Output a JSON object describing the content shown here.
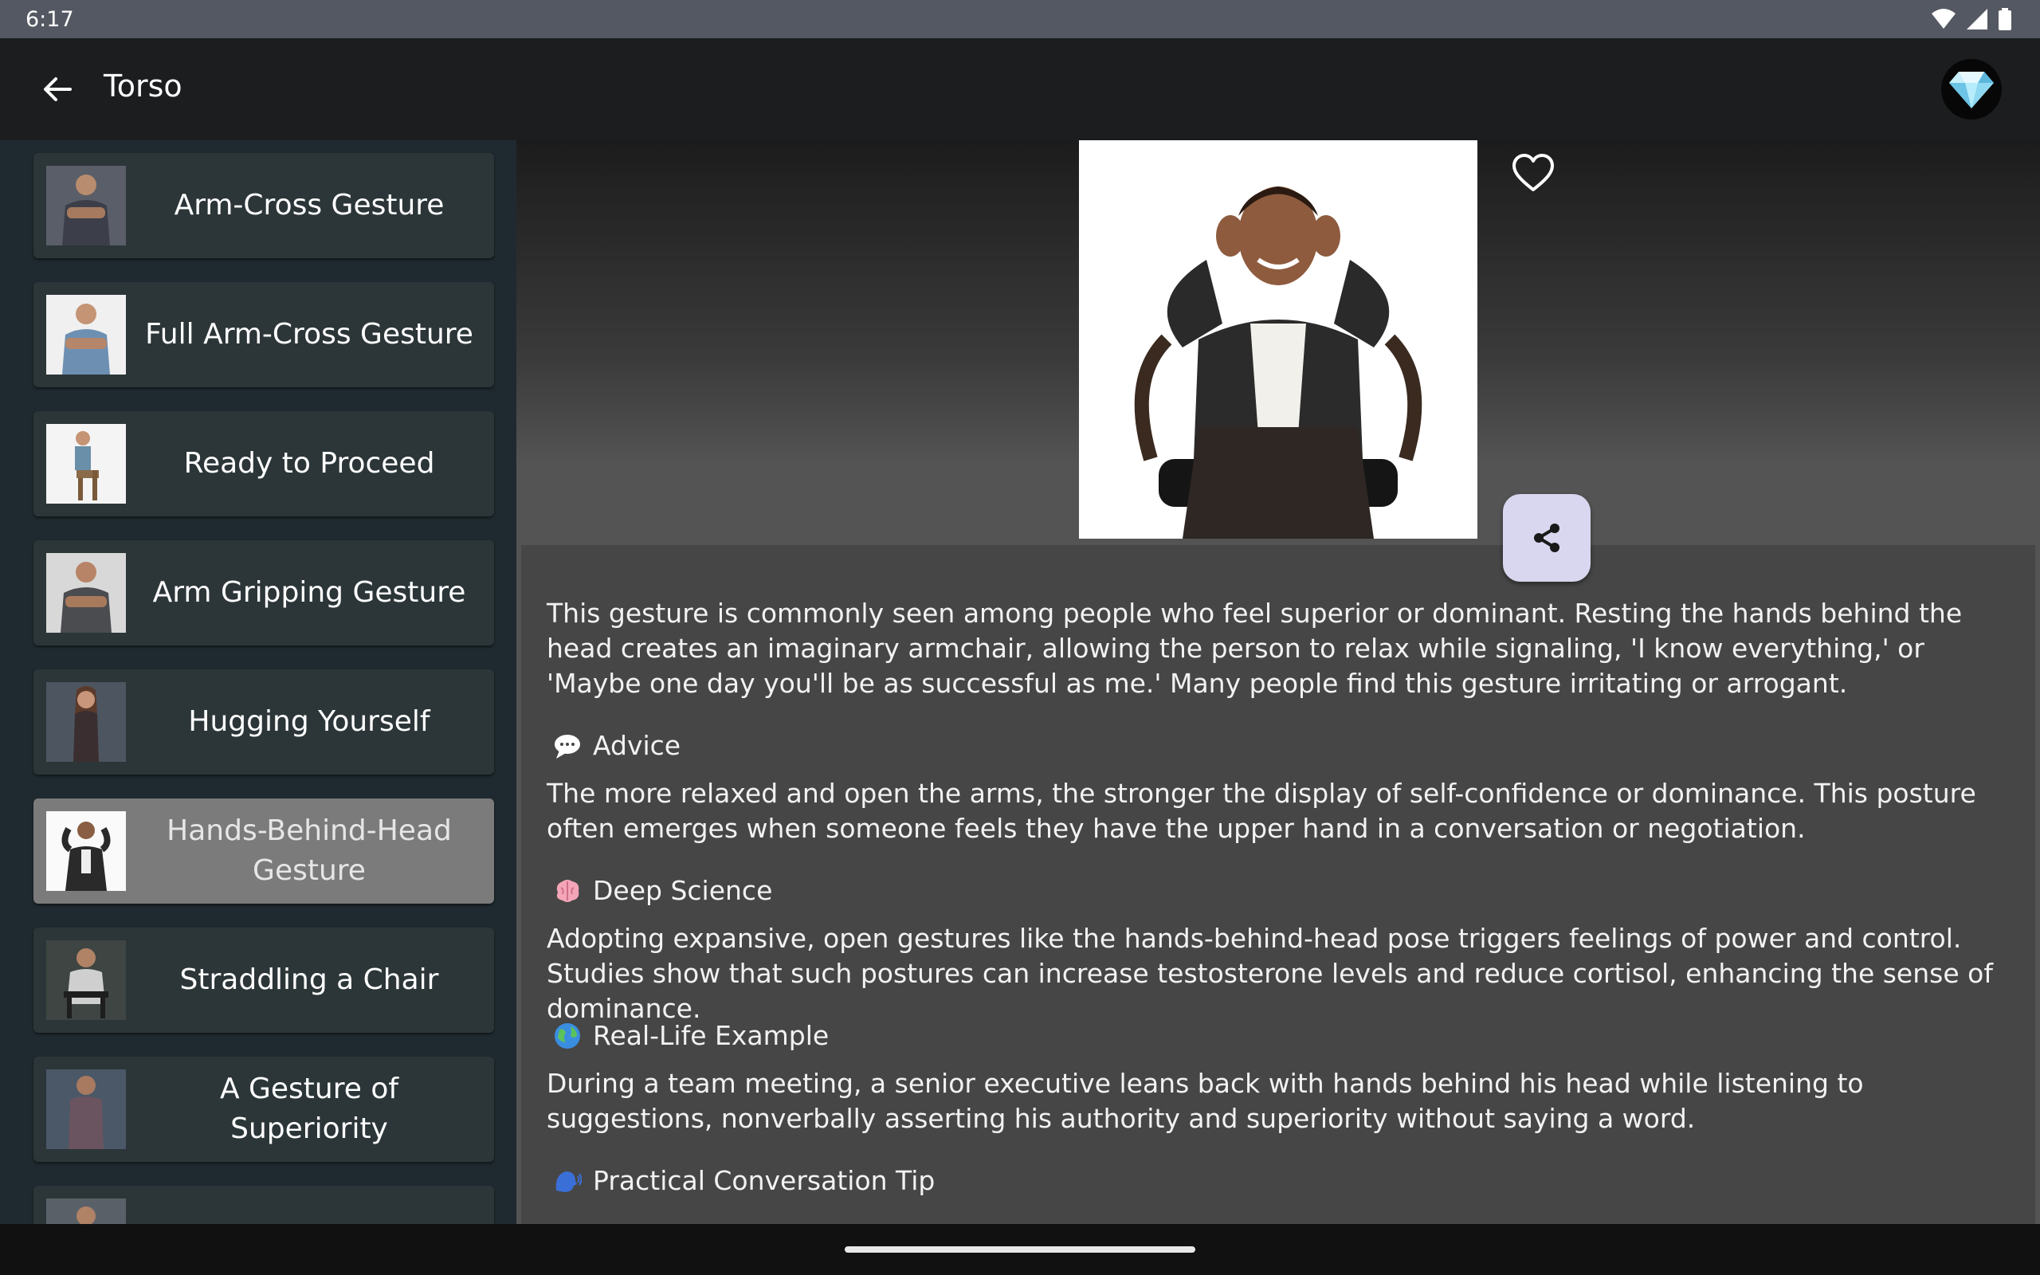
{
  "status": {
    "time": "6:17"
  },
  "appbar": {
    "title": "Torso"
  },
  "sidebar": {
    "items": [
      {
        "label": "Arm-Cross Gesture",
        "active": false
      },
      {
        "label": "Full Arm-Cross Gesture",
        "active": false
      },
      {
        "label": "Ready to Proceed",
        "active": false
      },
      {
        "label": "Arm Gripping Gesture",
        "active": false
      },
      {
        "label": "Hugging Yourself",
        "active": false
      },
      {
        "label": "Hands-Behind-Head Gesture",
        "active": true
      },
      {
        "label": "Straddling a Chair",
        "active": false
      },
      {
        "label": "A Gesture of Superiority",
        "active": false
      }
    ]
  },
  "detail": {
    "intro": "This gesture is commonly seen among people who feel superior or dominant. Resting the hands behind the head creates an imaginary armchair, allowing the person to relax while signaling, 'I know everything,' or 'Maybe one day you'll be as successful as me.' Many people find this gesture irritating or arrogant.",
    "sections": [
      {
        "title": "Advice",
        "icon": "speech-bubble-icon",
        "text": "The more relaxed and open the arms, the stronger the display of self-confidence or dominance. This posture often emerges when someone feels they have the upper hand in a conversation or negotiation."
      },
      {
        "title": "Deep Science",
        "icon": "brain-icon",
        "text": "Adopting expansive, open gestures like the hands-behind-head pose triggers feelings of power and control. Studies show that such postures can increase testosterone levels and reduce cortisol, enhancing the sense of dominance."
      },
      {
        "title": "Real-Life Example",
        "icon": "globe-icon",
        "text": "During a team meeting, a senior executive leans back with hands behind his head while listening to suggestions, nonverbally asserting his authority and superiority without saying a word."
      },
      {
        "title": "Practical Conversation Tip",
        "icon": "speaking-head-icon",
        "text": ""
      }
    ]
  },
  "colors": {
    "accent_button": "#d8d7ef",
    "active_item": "#7b7b7b",
    "item": "#2c3639"
  }
}
